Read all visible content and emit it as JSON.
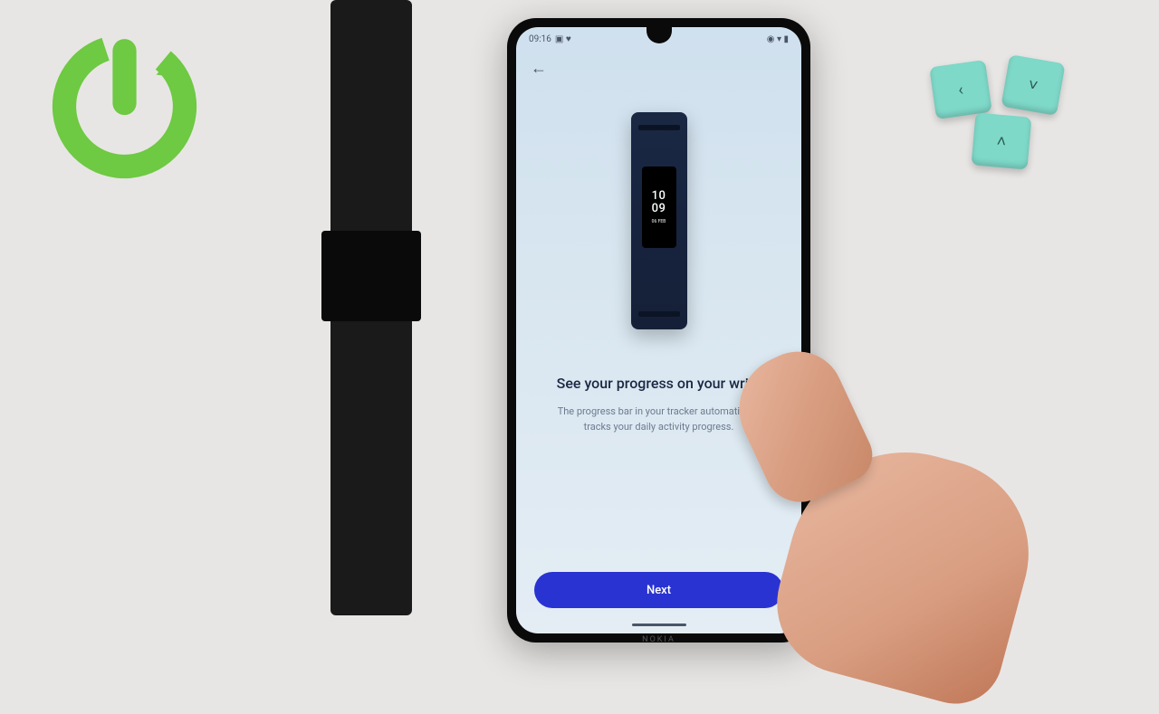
{
  "status": {
    "time": "09:16",
    "icons_left": "🅱 ♥",
    "icons_right": "🔵 📶 🔋"
  },
  "screen": {
    "headline": "See your progress on your wrist",
    "description": "The progress bar in your tracker automatically tracks your daily activity progress.",
    "next_label": "Next"
  },
  "tracker": {
    "time_line1": "10",
    "time_line2": "09",
    "date": "06 FEB"
  },
  "phone": {
    "brand": "NOKIA"
  }
}
